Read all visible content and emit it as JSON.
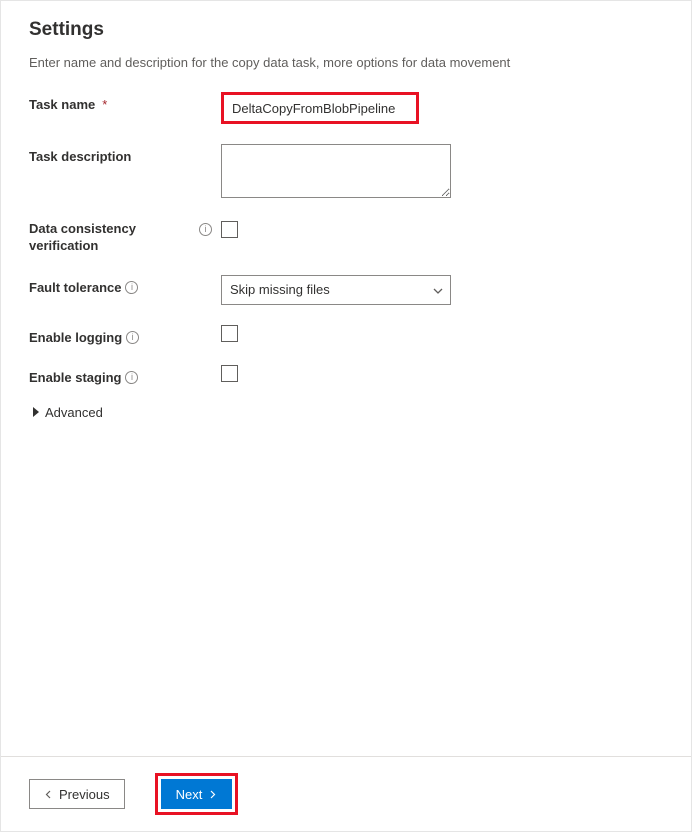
{
  "page": {
    "title": "Settings",
    "subtitle": "Enter name and description for the copy data task, more options for data movement"
  },
  "form": {
    "task_name": {
      "label": "Task name",
      "value": "DeltaCopyFromBlobPipeline",
      "required": "*"
    },
    "task_description": {
      "label": "Task description",
      "value": ""
    },
    "data_consistency": {
      "label": "Data consistency verification"
    },
    "fault_tolerance": {
      "label": "Fault tolerance",
      "selected": "Skip missing files"
    },
    "enable_logging": {
      "label": "Enable logging"
    },
    "enable_staging": {
      "label": "Enable staging"
    },
    "advanced": {
      "label": "Advanced"
    }
  },
  "footer": {
    "previous": "Previous",
    "next": "Next"
  }
}
